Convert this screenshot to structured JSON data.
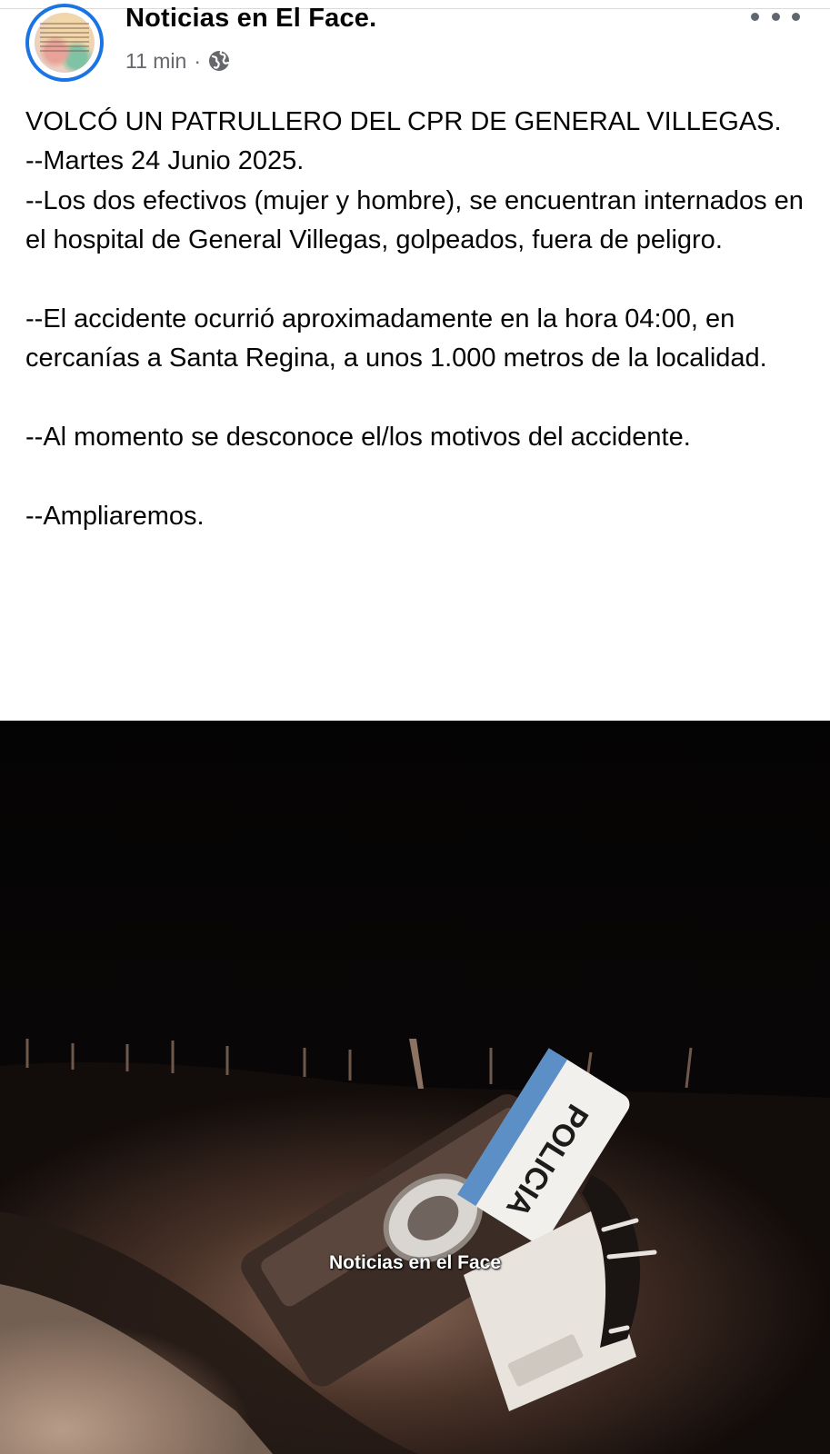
{
  "post": {
    "page_name": "Noticias en El Face.",
    "time": "11 min",
    "separator": "·",
    "audience_icon": "globe-icon",
    "more_icon": "more-options-icon",
    "avatar_icon": "page-avatar",
    "lines": [
      "VOLCÓ UN PATRULLERO DEL CPR DE GENERAL VILLEGAS.",
      "--Martes 24 Junio 2025.",
      "--Los dos efectivos (mujer y hombre), se encuentran internados en el hospital de General Villegas, golpeados, fuera de peligro.",
      "",
      "--El accidente ocurrió aproximadamente en la hora 04:00, en cercanías a Santa Regina, a unos 1.000 metros de la localidad.",
      "",
      "--Al momento se desconoce el/los motivos del accidente.",
      "",
      "--Ampliaremos."
    ]
  },
  "photo": {
    "watermark": "Noticias en el Face",
    "vehicle_text": "POLICIA"
  },
  "colors": {
    "accent": "#1b74e4",
    "text": "#050505",
    "meta": "#65676b",
    "photo_bg": "#070504"
  }
}
